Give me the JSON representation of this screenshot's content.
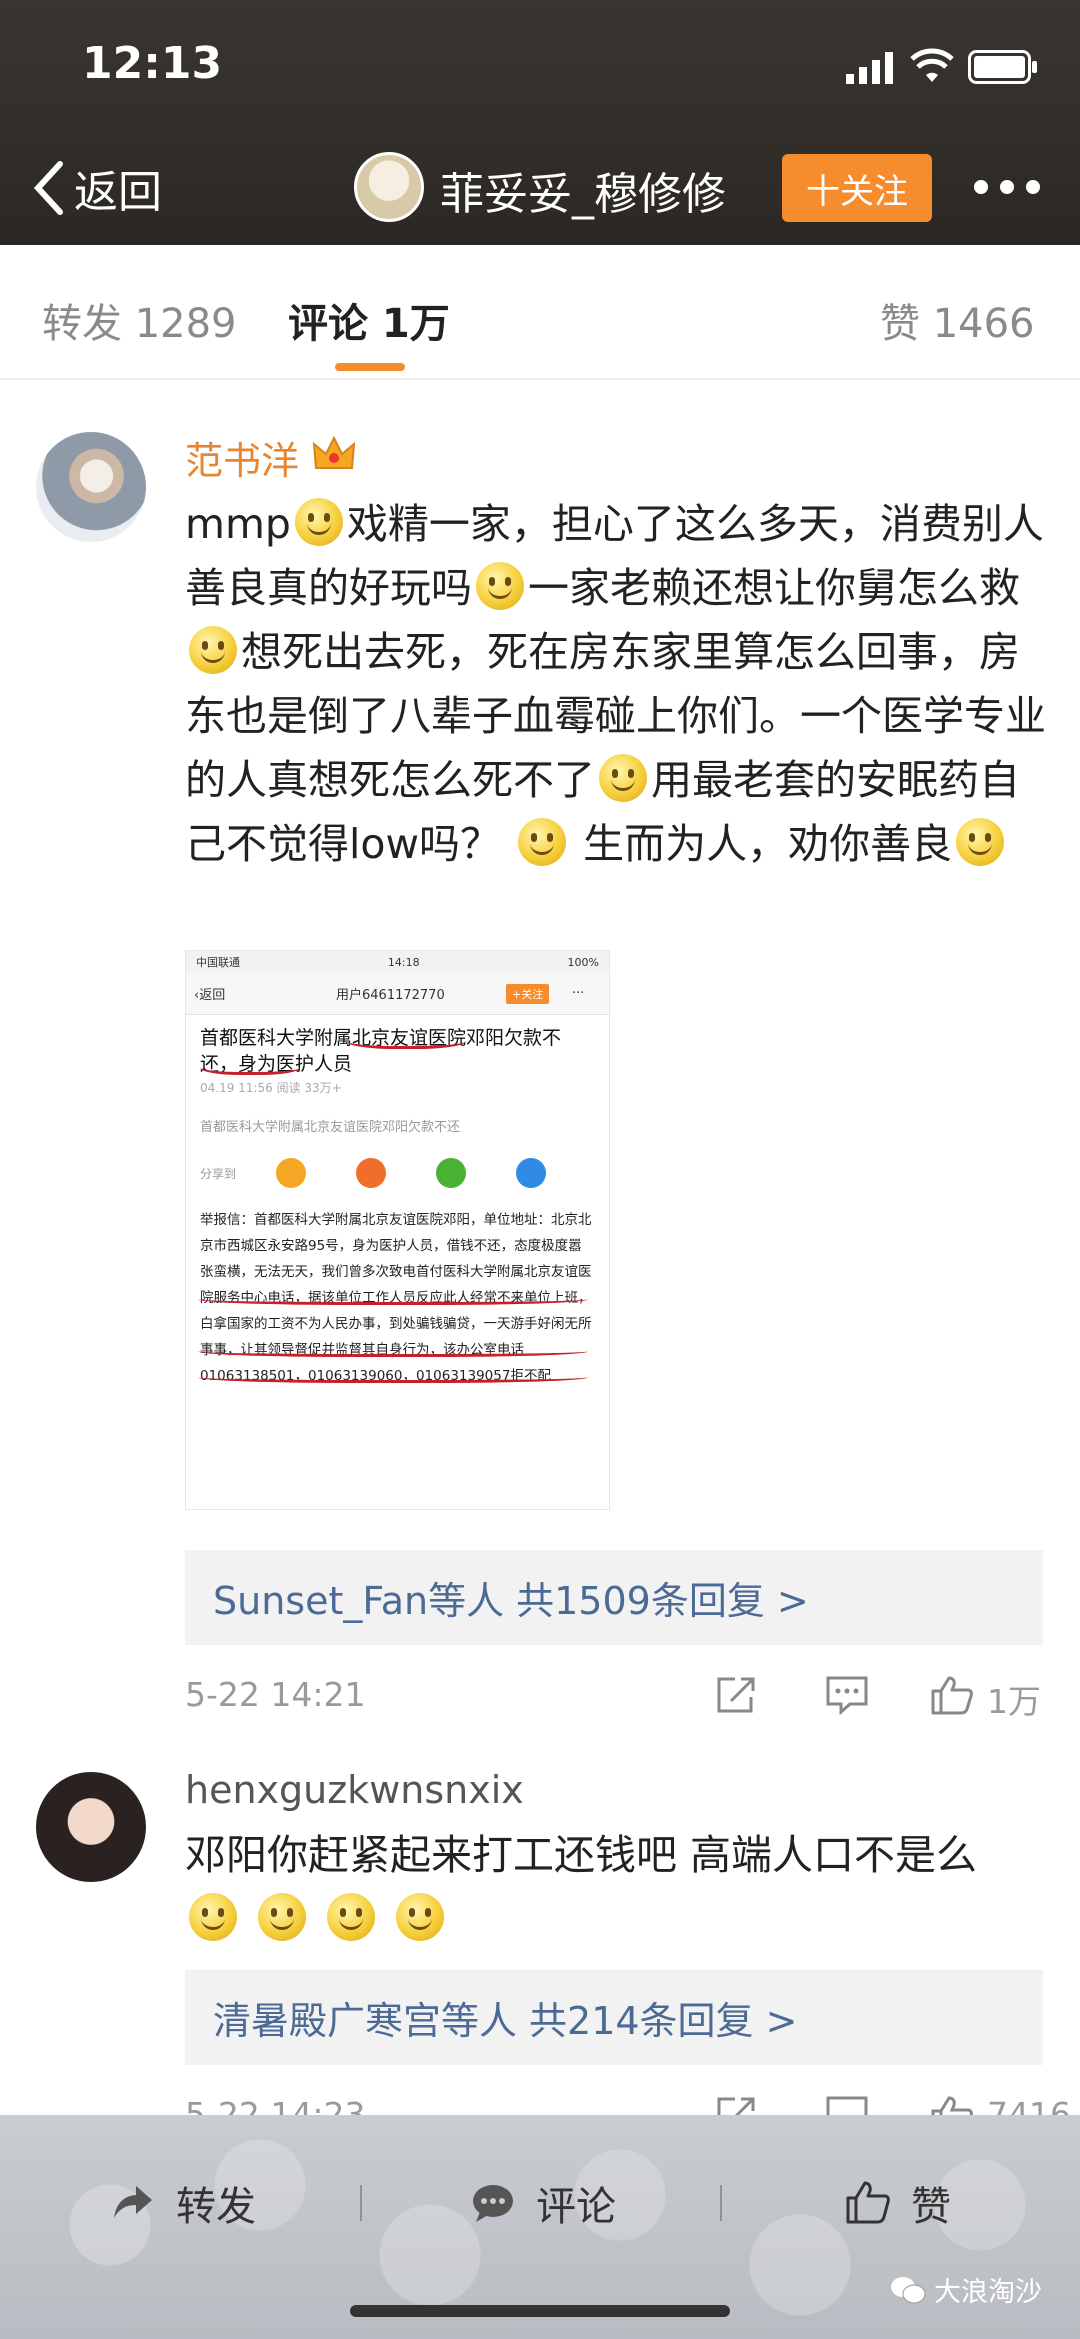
{
  "status": {
    "time": "12:13"
  },
  "nav": {
    "back_label": "返回",
    "title": "菲妥妥_穆修修",
    "follow_label": "十关注"
  },
  "tabs": {
    "repost": "转发 1289",
    "comments": "评论 1万",
    "likes": "赞 1466"
  },
  "comments": [
    {
      "username": "范书洋",
      "text_parts": [
        "mmp",
        "戏精一家，担心了这么多天，消费别人善良真的好玩吗",
        "一家老赖还想让你舅怎么救",
        "想死出去死，死在房东家里算怎么回事，房东也是倒了八辈子血霉碰上你们。一个医学专业的人真想死怎么死不了",
        "用最老套的安眠药自己不觉得low吗？",
        "生而为人，劝你善良"
      ],
      "reply_names": "Sunset_Fan等人",
      "reply_count": "共1509条回复 >",
      "time": "5-22 14:21",
      "like_count": "1万"
    },
    {
      "username": "henxguzkwnsnxix",
      "text": "邓阳你赶紧起来打工还钱吧 高端人口不是么",
      "reply_names": "清暑殿广寒宫等人",
      "reply_count": "共214条回复 >",
      "time": "5-22 14:23",
      "like_count": "7416"
    }
  ],
  "embedded": {
    "carrier": "中国联通",
    "time": "14:18",
    "battery": "100%",
    "back": "返回",
    "user": "用户6461172770",
    "follow": "+关注",
    "more": "···",
    "title": "首都医科大学附属北京友谊医院邓阳欠款不还，身为医护人员",
    "meta": "04.19 11:56  阅读 33万+",
    "summary": "首都医科大学附属北京友谊医院邓阳欠款不还",
    "share_label": "分享到",
    "body": "举报信：首都医科大学附属北京友谊医院邓阳，单位地址：北京北京市西城区永安路95号，身为医护人员，借钱不还，态度极度嚣张蛮横，无法无天，我们曾多次致电首付医科大学附属北京友谊医院服务中心电话，据该单位工作人员反应此人经常不来单位上班，白拿国家的工资不为人民办事，到处骗钱骗贷，一天游手好闲无所事事，让其领导督促并监督其自身行为，该办公室电话01063138501，01063139060，01063139057拒不配"
  },
  "bottom": {
    "repost": "转发",
    "comment": "评论",
    "like": "赞"
  },
  "watermark": "大浪淘沙",
  "colors": {
    "accent": "#f78c2c",
    "link": "#4b6a95",
    "username_vip": "#e8852e"
  }
}
